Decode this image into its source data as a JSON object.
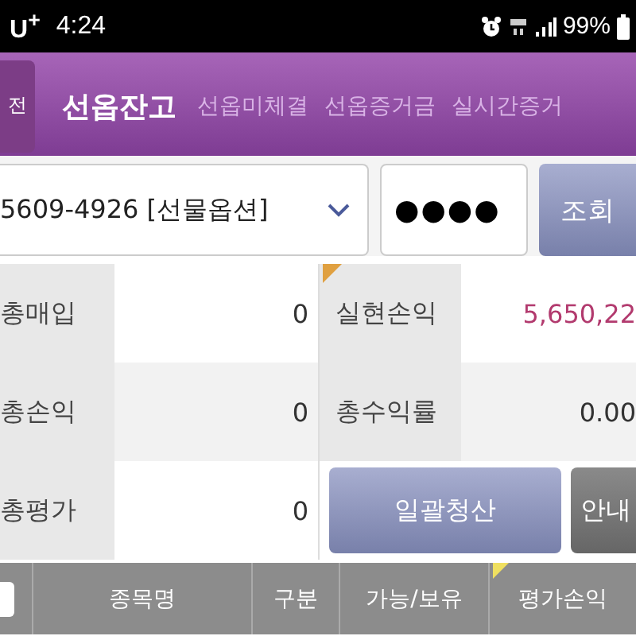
{
  "status_bar": {
    "carrier": "U$^{+}$",
    "time": "4:24",
    "battery": "99%"
  },
  "back_button": {
    "label": "전"
  },
  "tabs": [
    {
      "label": "선옵잔고",
      "selected": true
    },
    {
      "label": "선옵미체결",
      "selected": false
    },
    {
      "label": "선옵증거금",
      "selected": false
    },
    {
      "label": "실시간증거",
      "selected": false
    }
  ],
  "account": {
    "value": "5609-4926 [선물옵션]"
  },
  "password": {
    "value": "●●●●"
  },
  "query_button": "조회",
  "summary_left": [
    {
      "label": "총매입",
      "value": "0"
    },
    {
      "label": "총손익",
      "value": "0"
    },
    {
      "label": "총평가",
      "value": "0"
    }
  ],
  "summary_right": [
    {
      "label": "실현손익",
      "value": "5,650,22",
      "color": "#b23a6e",
      "marked": true
    },
    {
      "label": "총수익률",
      "value": "0.00",
      "color": "#333333",
      "marked": false
    }
  ],
  "actions": [
    {
      "label": "일괄청산",
      "kind": "primary"
    },
    {
      "label": "안내",
      "kind": "secondary"
    }
  ],
  "table": {
    "select_all": {
      "checked": false
    },
    "columns": [
      {
        "label": "종목명",
        "marked": false
      },
      {
        "label": "구분",
        "marked": false
      },
      {
        "label": "가능/보유",
        "marked": false
      },
      {
        "label": "평가손익",
        "marked": true
      }
    ]
  }
}
